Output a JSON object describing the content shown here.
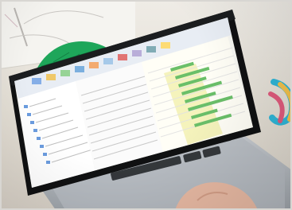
{
  "scene": {
    "description_tags": [
      "laptop-photo",
      "gantt-schedule-software"
    ],
    "colors": {
      "desk": "#e7e2d8",
      "desk_dark": "#c7bfb3",
      "paper": "#f5f4f0",
      "laptop_body": "#2b2d30",
      "laptop_bezel": "#101112",
      "keyboard_base": "#b9bcc0",
      "keys": "#2e3134",
      "screen_bg": "#f7f7f2",
      "ribbon": "#e8edf4",
      "gantt_highlight": "#f4f2b8",
      "gantt_bar": "#6abf69",
      "tree_icon": "#3a7bd5",
      "green_leaf": "#1ea65a",
      "hand": "#e6b8a2"
    }
  },
  "screen": {
    "app": {
      "type": "project-scheduling",
      "title_visible": false,
      "toolbar_visible": true,
      "tree_visible": true,
      "gantt_visible": true
    }
  }
}
